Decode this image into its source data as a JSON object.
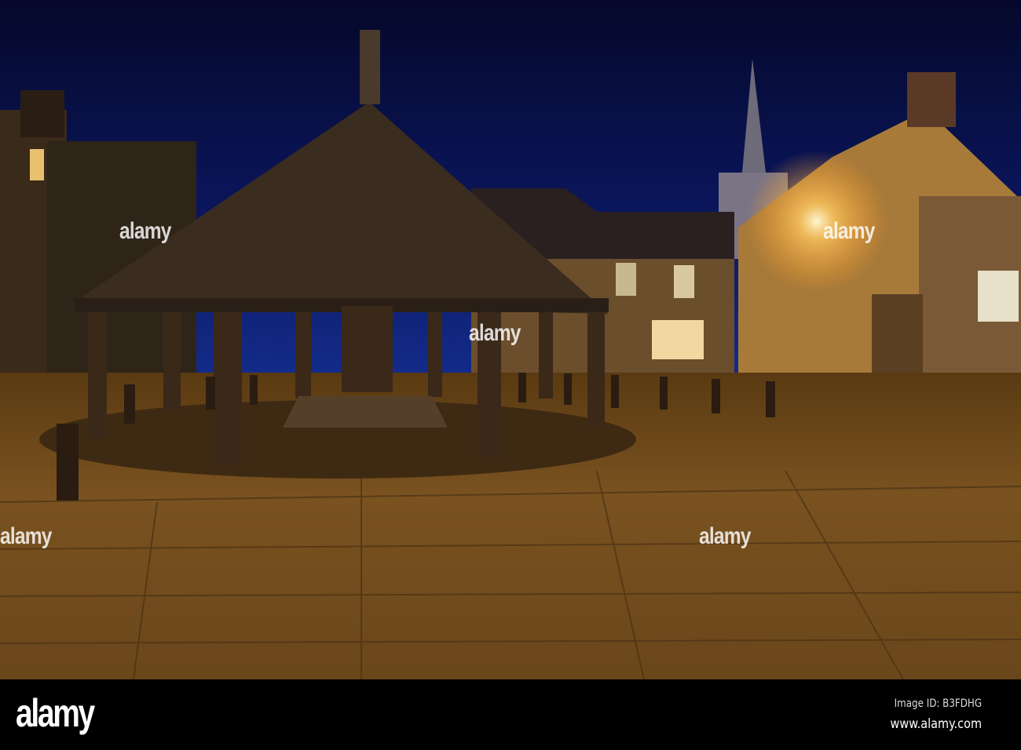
{
  "watermark": {
    "text": "alamy"
  },
  "footer": {
    "logo": "alamy",
    "image_id": "Image ID: B3FDHG",
    "website": "www.alamy.com"
  }
}
